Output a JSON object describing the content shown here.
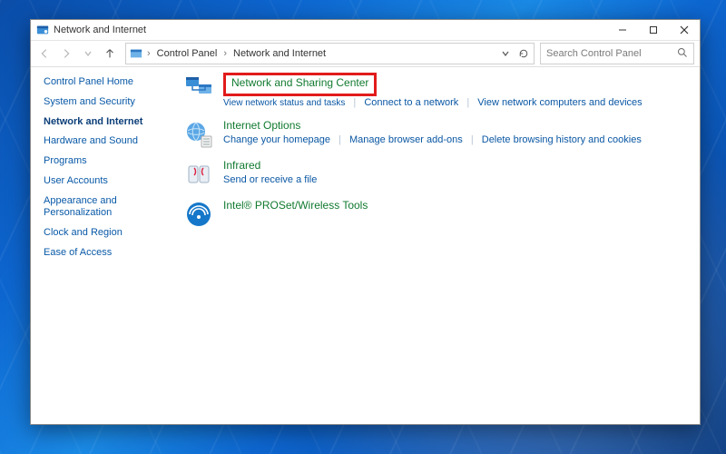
{
  "window": {
    "title": "Network and Internet"
  },
  "breadcrumb": {
    "root_glyph": "▸",
    "seg1": "Control Panel",
    "seg2": "Network and Internet"
  },
  "search": {
    "placeholder": "Search Control Panel"
  },
  "sidebar": {
    "items": [
      {
        "label": "Control Panel Home"
      },
      {
        "label": "System and Security"
      },
      {
        "label": "Network and Internet",
        "selected": true
      },
      {
        "label": "Hardware and Sound"
      },
      {
        "label": "Programs"
      },
      {
        "label": "User Accounts"
      },
      {
        "label": "Appearance and Personalization"
      },
      {
        "label": "Clock and Region"
      },
      {
        "label": "Ease of Access"
      }
    ]
  },
  "categories": [
    {
      "id": "net-sharing",
      "title": "Network and Sharing Center",
      "highlight": true,
      "tasks": [
        {
          "label": "View network status and tasks",
          "obscured": true
        },
        {
          "label": "Connect to a network"
        },
        {
          "label": "View network computers and devices"
        }
      ],
      "icon": "network-sharing-icon"
    },
    {
      "id": "internet-options",
      "title": "Internet Options",
      "tasks": [
        {
          "label": "Change your homepage"
        },
        {
          "label": "Manage browser add-ons"
        },
        {
          "label": "Delete browsing history and cookies"
        }
      ],
      "icon": "internet-options-icon"
    },
    {
      "id": "infrared",
      "title": "Infrared",
      "tasks": [
        {
          "label": "Send or receive a file"
        }
      ],
      "icon": "infrared-icon"
    },
    {
      "id": "intel-wireless",
      "title": "Intel® PROSet/Wireless Tools",
      "tasks": [],
      "icon": "intel-wireless-icon"
    }
  ]
}
